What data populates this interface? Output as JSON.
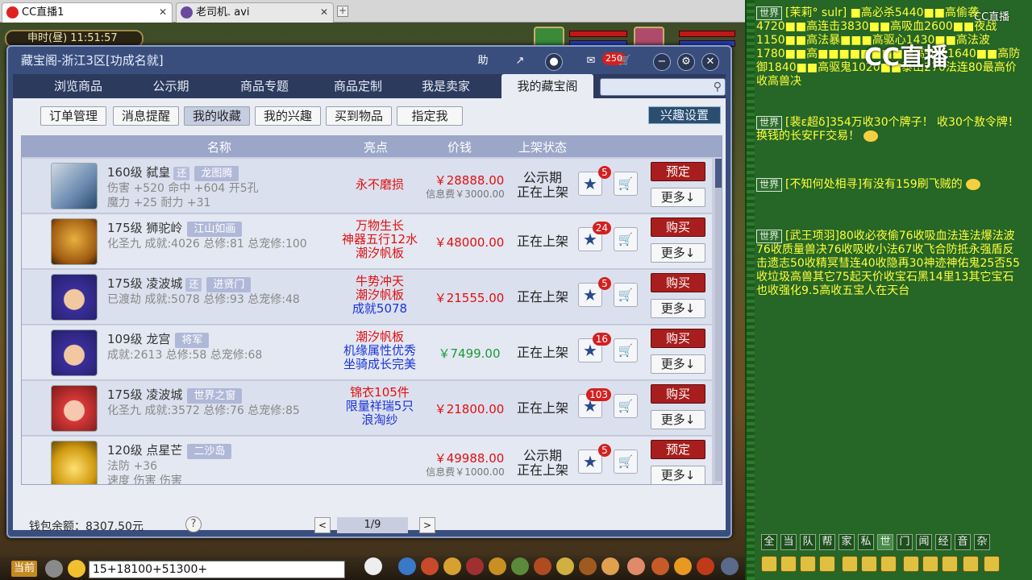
{
  "browser_tabs": [
    {
      "label": "CC直播1",
      "close": "✕"
    },
    {
      "label": "老司机. avi",
      "close": "✕"
    }
  ],
  "new_tab": "+",
  "game_clock": "申时(昼) 11:51:57",
  "window": {
    "title": "藏宝阁-浙江3区[功成名就]",
    "controls": {
      "help": "助",
      "notification_count": "250"
    },
    "nav_tabs": [
      "浏览商品",
      "公示期",
      "商品专题",
      "商品定制",
      "我是卖家",
      "我的藏宝阁"
    ],
    "active_nav": "我的藏宝阁",
    "search_placeholder": "",
    "sub_tabs": [
      "订单管理",
      "消息提醒",
      "我的收藏",
      "我的兴趣",
      "买到物品",
      "指定我"
    ],
    "active_sub": "我的收藏",
    "interest_settings": "兴趣设置",
    "columns": {
      "name": "名称",
      "highlight": "亮点",
      "price": "价钱",
      "status": "上架状态"
    },
    "wallet": "钱包余额：8307.50元",
    "help_mark": "?",
    "pagination": {
      "prev": "<",
      "page": "1/9",
      "next": ">"
    }
  },
  "items": [
    {
      "line1": "160级  弑皇",
      "tag_small": "还",
      "tag": "龙图腾",
      "line2": "伤害 +520 命中 +604 开5孔",
      "line3": "魔力 +25 耐力 +31",
      "highlights": [
        {
          "text": "永不磨损",
          "color": "red"
        }
      ],
      "price": "￥28888.00",
      "fee": "信息费￥3000.00",
      "status": [
        "公示期",
        "正在上架"
      ],
      "fav_count": "5",
      "action": "预定",
      "more": "更多↓"
    },
    {
      "line1": "175级  狮驼岭",
      "tag_small": "",
      "tag": "江山如画",
      "line2": "化圣九 成就:4026 总修:81 总宠修:100",
      "line3": "",
      "highlights": [
        {
          "text": "万物生长",
          "color": "red"
        },
        {
          "text": "神器五行12水",
          "color": "red"
        },
        {
          "text": "潮汐帆板",
          "color": "red"
        }
      ],
      "price": "￥48000.00",
      "fee": "",
      "status": [
        "正在上架"
      ],
      "fav_count": "24",
      "action": "购买",
      "more": "更多↓"
    },
    {
      "line1": "175级  凌波城",
      "tag_small": "还",
      "tag": "进贤门",
      "line2": "已渡劫 成就:5078 总修:93 总宠修:48",
      "line3": "",
      "highlights": [
        {
          "text": "牛势冲天",
          "color": "red"
        },
        {
          "text": "潮汐帆板",
          "color": "red"
        },
        {
          "text": "成就5078",
          "color": "blue"
        }
      ],
      "price": "￥21555.00",
      "fee": "",
      "status": [
        "正在上架"
      ],
      "fav_count": "5",
      "action": "购买",
      "more": "更多↓"
    },
    {
      "line1": "109级  龙宫",
      "tag_small": "",
      "tag": "将军",
      "line2": "成就:2613 总修:58 总宠修:68",
      "line3": "",
      "highlights": [
        {
          "text": "潮汐帆板",
          "color": "red"
        },
        {
          "text": "机缘属性优秀",
          "color": "blue"
        },
        {
          "text": "坐骑成长完美",
          "color": "blue"
        }
      ],
      "price": "￥7499.00",
      "price_color": "green",
      "fee": "",
      "status": [
        "正在上架"
      ],
      "fav_count": "16",
      "action": "购买",
      "more": "更多↓"
    },
    {
      "line1": "175级  凌波城",
      "tag_small": "",
      "tag": "世界之窗",
      "line2": "化圣九 成就:3572 总修:76 总宠修:85",
      "line3": "",
      "highlights": [
        {
          "text": "锦衣105件",
          "color": "red"
        },
        {
          "text": "限量祥瑞5只",
          "color": "blue"
        },
        {
          "text": "浪淘纱",
          "color": "blue"
        }
      ],
      "price": "￥21800.00",
      "fee": "",
      "status": [
        "正在上架"
      ],
      "fav_count": "103",
      "action": "购买",
      "more": "更多↓"
    },
    {
      "line1": "120级  点星芒",
      "tag_small": "",
      "tag": "二沙岛",
      "line2": "法防 +36",
      "line3": "速度 伤害 伤害",
      "highlights": [],
      "price": "￥49988.00",
      "fee": "信息费￥1000.00",
      "status": [
        "公示期",
        "正在上架"
      ],
      "fav_count": "5",
      "action": "预定",
      "more": "更多↓"
    }
  ],
  "bottom": {
    "current_channel": "当前",
    "chat_input": "15+18100+51300+"
  },
  "chat_panel": {
    "world_tag": "世界",
    "messages": [
      "[茉莉° sulr] ■高必杀5440■■高偷袭4720■■高连击3830■■高吸血2600■■夜战1150■■高法暴■■■高驱心1430■■高法波1780■■高■■■■■■■■■高强力1640■■高防御1840■■高驱鬼1020■■泰山270法连80最高价收高兽决",
      "[裴ε超δ]354万收30个牌子！ 收30个敖令牌！ 换钱的长安FF交易！",
      "[不知何处相寻]有没有159刷飞贼的",
      "[武王项羽]80收必夜偷76收吸血法连法爆法波76收质量兽决76收吸收小法67收飞合防抵永强盾反击遗志50收精冥彗连40收隐再30神迹神佑鬼25否55收垃圾高兽其它75起天价收宝石黑14里13其它宝石也收强化9.5高收五宝人在天台"
    ],
    "channels": [
      "全",
      "当",
      "队",
      "帮",
      "家",
      "私",
      "世",
      "门",
      "闻",
      "经",
      "音",
      "杂"
    ],
    "active_channel": "世"
  },
  "watermark": "CC直播",
  "watermark_small": "CC直播"
}
